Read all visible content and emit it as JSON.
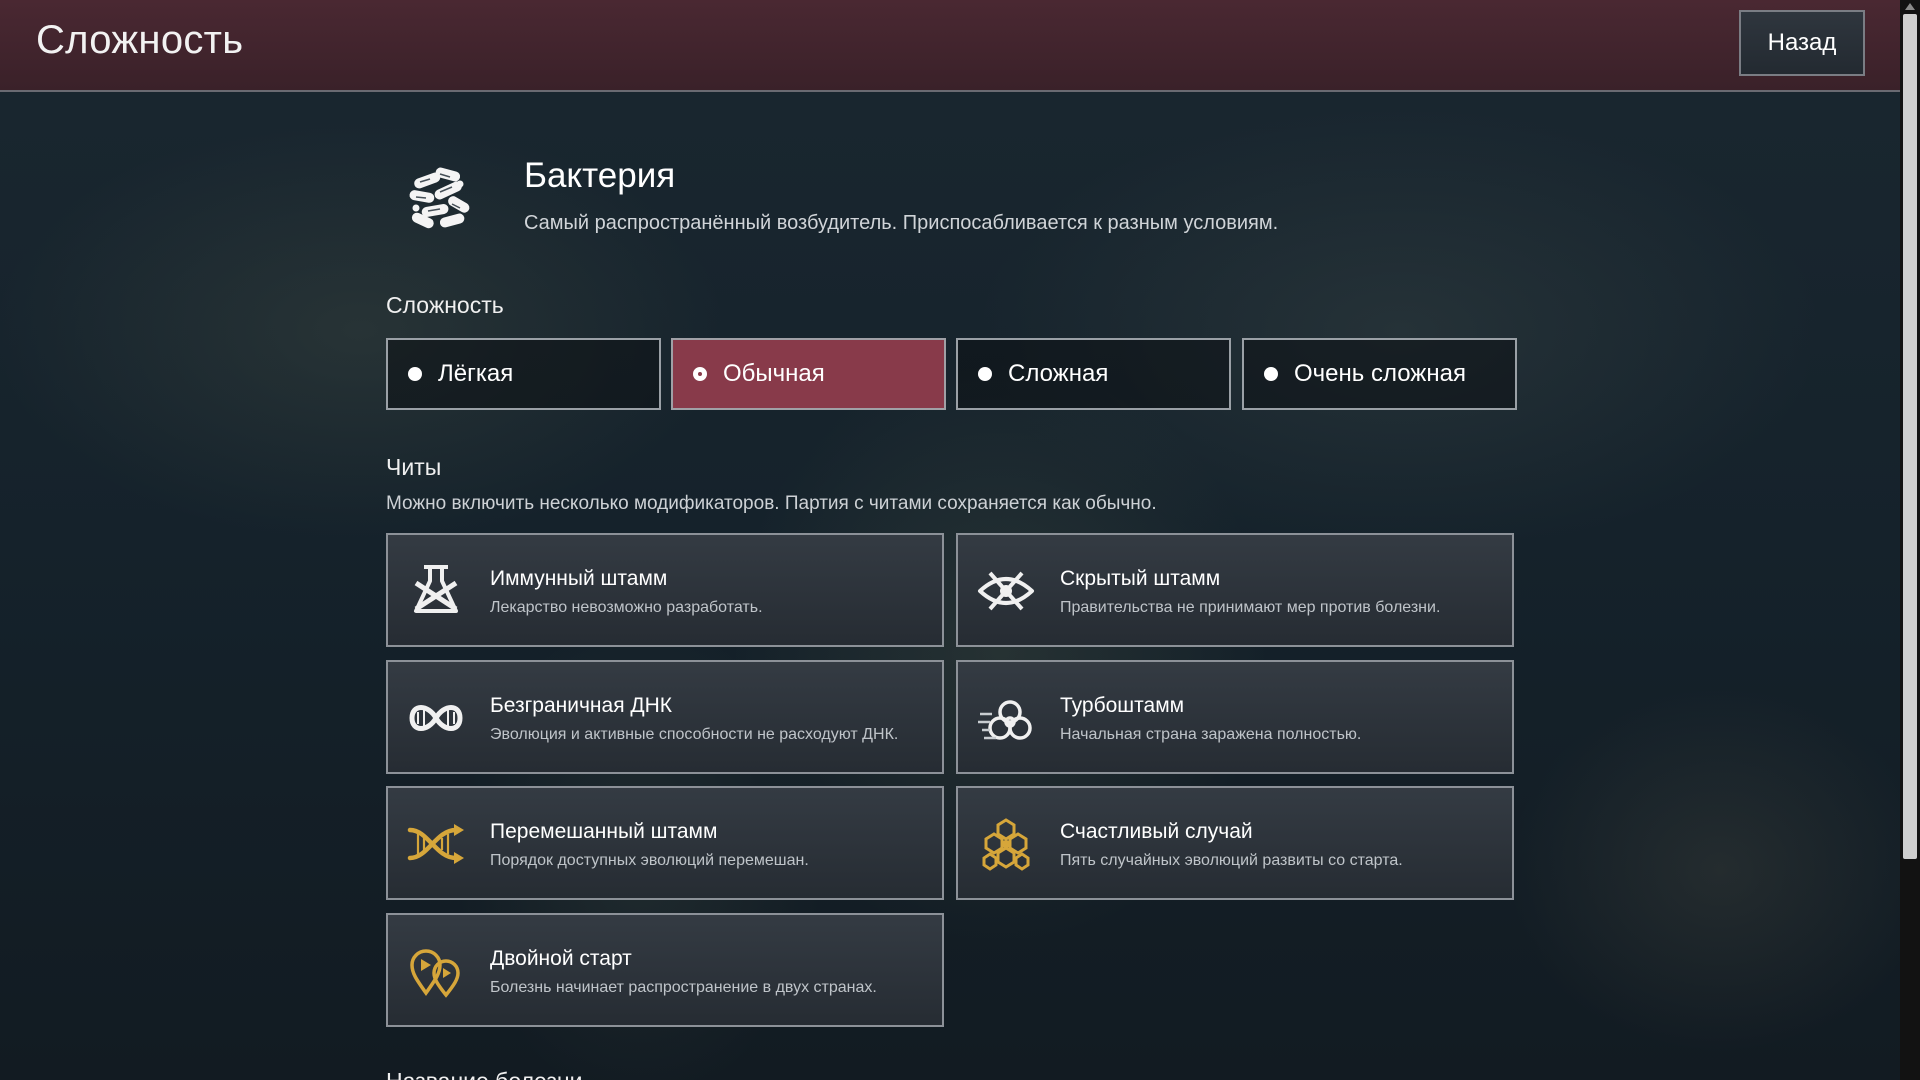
{
  "header": {
    "title": "Сложность",
    "back_label": "Назад"
  },
  "pathogen": {
    "name": "Бактерия",
    "description": "Самый распространённый возбудитель. Приспосабливается к разным условиям.",
    "icon": "bacteria-icon"
  },
  "difficulty": {
    "title": "Сложность",
    "options": [
      {
        "label": "Лёгкая",
        "selected": false
      },
      {
        "label": "Обычная",
        "selected": true
      },
      {
        "label": "Сложная",
        "selected": false
      },
      {
        "label": "Очень сложная",
        "selected": false
      }
    ],
    "selected_color": "#883a4a"
  },
  "cheats": {
    "title": "Читы",
    "description": "Можно включить несколько модификаторов. Партия с читами сохраняется как обычно.",
    "items": [
      {
        "title": "Иммунный штамм",
        "description": "Лекарство невозможно разработать.",
        "icon": "flask-icon"
      },
      {
        "title": "Скрытый штамм",
        "description": "Правительства не принимают мер против болезни.",
        "icon": "hidden-strain-icon"
      },
      {
        "title": "Безграничная ДНК",
        "description": "Эволюция и активные способности не расходуют ДНК.",
        "icon": "infinity-dna-icon"
      },
      {
        "title": "Турбоштамм",
        "description": "Начальная страна заражена полностью.",
        "icon": "biohazard-icon"
      },
      {
        "title": "Перемешанный штамм",
        "description": "Порядок доступных эволюций перемешан.",
        "icon": "shuffle-dna-icon"
      },
      {
        "title": "Счастливый случай",
        "description": "Пять случайных эволюций развиты со старта.",
        "icon": "hexagons-icon"
      },
      {
        "title": "Двойной старт",
        "description": "Болезнь начинает распространение в двух странах.",
        "icon": "double-pin-icon"
      }
    ]
  },
  "disease_name": {
    "label": "Название болезни"
  },
  "colors": {
    "header": "#3f232c",
    "accent": "#883a4a",
    "gold": "#d6a63a"
  }
}
